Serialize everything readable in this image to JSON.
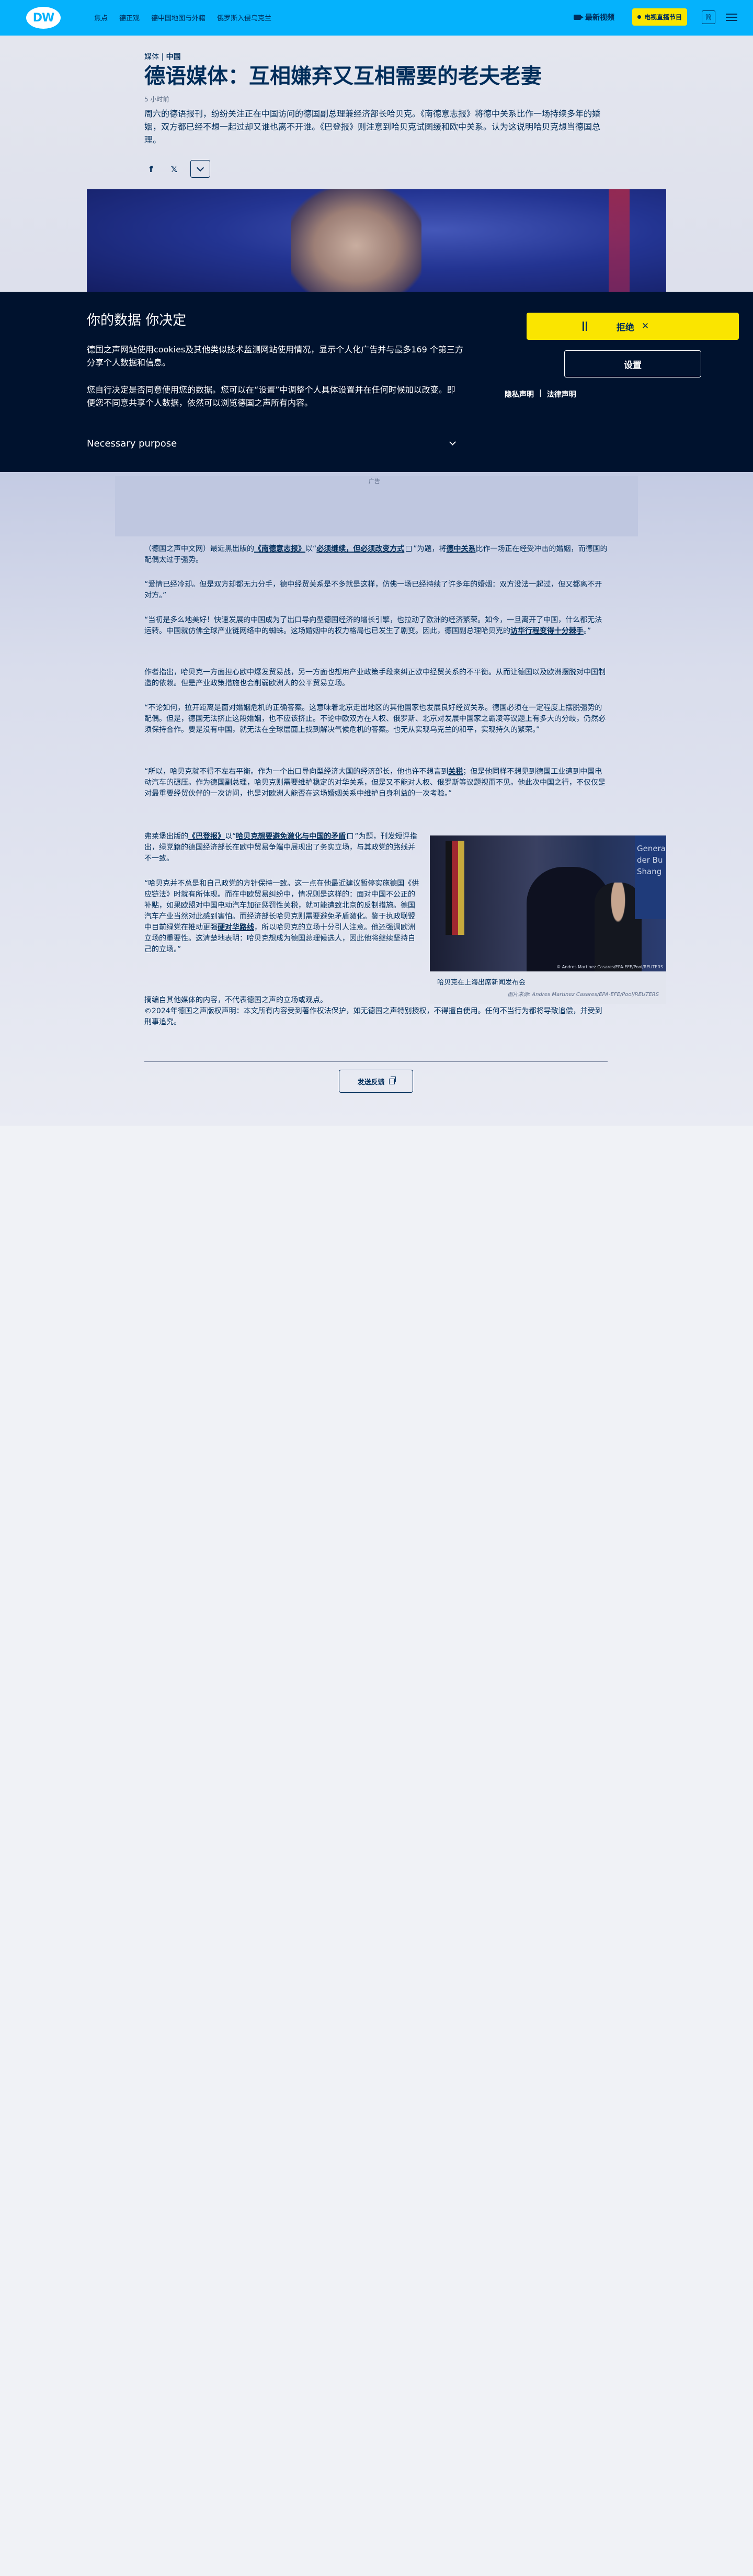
{
  "header": {
    "logo": "DW",
    "nav": [
      "焦点",
      "德正观",
      "德中国地图与外籍",
      "俄罗斯入侵乌克兰"
    ],
    "latest_video": "最新视频",
    "live_tv": "电视直播节目",
    "lang": "简"
  },
  "article": {
    "kicker_prefix": "媒体 |",
    "kicker_tag": "中国",
    "title": "德语媒体：互相嫌弃又互相需要的老夫老妻",
    "time": "5 小时前",
    "lead": "周六的德语报刊，纷纷关注正在中国访问的德国副总理兼经济部长哈贝克。《南德意志报》将德中关系比作一场持续多年的婚姻，双方都已经不想一起过却又谁也离不开谁。《巴登报》则注意到哈贝克试图缓和欧中关系。认为这说明哈贝克想当德国总理。"
  },
  "cookie": {
    "title": "你的数据 你决定",
    "p1": "德国之声网站使用cookies及其他类似技术监测网站使用情况，显示个人化广告并与最多169 个第三方分享个人数据和信息。",
    "p2": "您自行决定是否同意使用您的数据。您可以在“设置”中调整个人具体设置并在任何时候加以改变。即便您不同意共享个人数据，依然可以浏览德国之声所有内容。",
    "purpose": "Necessary purpose",
    "reject": "拒绝",
    "settings": "设置",
    "privacy": "隐私声明",
    "sep": "|",
    "legal": "法律声明"
  },
  "ad_label": "广告",
  "body": {
    "p1_a": "（德国之声中文网）最近黑出版的",
    "p1_link1": "《南德意志报》",
    "p1_b": "以“",
    "p1_link2": "必须继续，但必须改变方式",
    "p1_c": "”为题，将",
    "p1_link3": "德中关系",
    "p1_d": "比作一场正在经受冲击的婚姻，而德国的配偶太过于强势。",
    "p2": "“爱情已经冷却。但是双方却都无力分手，德中经贸关系是不多就是这样，仿佛一场已经持续了许多年的婚姻：双方没法一起过，但又都离不开对方。”",
    "p3_a": "“当初是多么地美好！快速发展的中国成为了出口导向型德国经济的增长引擎，也拉动了欧洲的经济繁荣。如今，一旦离开了中国，什么都无法运转。中国就仿佛全球产业链网络中的蜘蛛。这场婚姻中的权力格局也已发生了剧变。因此，德国副总理哈贝克的",
    "p3_link": "访华行程变得十分棘手",
    "p3_b": "。”",
    "p4": "作者指出，哈贝克一方面担心欧中爆发贸易战，另一方面也想用产业政策手段来纠正欧中经贸关系的不平衡。从而让德国以及欧洲摆脱对中国制造的依赖。但是产业政策措施也会削弱欧洲人的公平贸易立场。",
    "p5": "“不论如何，拉开距离是面对婚姻危机的正确答案。这意味着北京走出地区的其他国家也发展良好经贸关系。德国必须在一定程度上摆脱强势的配偶。但是，德国无法挤止这段婚姻，也不应该挤止。不论中欧双方在人权、俄罗斯、北京对发展中国家之霸凌等议题上有多大的分歧，仍然必须保持合作。要是没有中国，就无法在全球层面上找到解决气候危机的答案。也无从实现乌克兰的和平，实现持久的繁荣。”",
    "p6_a": "“所以，哈贝克就不得不左右平衡。作为一个出口导向型经济大国的经济部长，他也许不想言到",
    "p6_link": "关税",
    "p6_b": "；但是他同样不想见到德国工业遭到中国电动汽车的碾压。作为德国副总理，哈贝克则需要维护稳定的对华关系，但是又不能对人权、俄罗斯等议题视而不见。他此次中国之行，不仅仅是对最重要经贸伙伴的一次访问，也是对欧洲人能否在这场婚姻关系中维护自身利益的一次考验。”",
    "p7_a": "弗莱堡出版的",
    "p7_link1": "《巴登报》",
    "p7_b": "以“",
    "p7_link2": "哈贝克想要避免激化与中国的矛盾",
    "p7_c": "”为题，刊发短评指出，绿党籍的德国经济部长在欧中贸易争端中展现出了务实立场，与其政党的路线并不一致。",
    "p8_a": "“哈贝克并不总是和自己政党的方针保持一致。这一点在他最近建议暂停实施德国《供应链法》时就有所体现。而在中欧贸易纠纷中，情况则是这样的：面对中国不公正的补贴，如果欧盟对中国电动汽车加征惩罚性关税，就可能遭致北京的反制措施。德国汽车产业当然对此感到害怕。而经济部长哈贝克则需要避免矛盾激化。鉴于执政联盟中目前绿党在推动更强",
    "p8_link": "硬对华路线",
    "p8_b": "，所以哈贝克的立场十分引人注意。他还强调欧洲立场的重要性。这清楚地表明：哈贝克想成为德国总理候选人，因此他将继续坚持自己的立场。”",
    "p9": "摘编自其他媒体的内容，不代表德国之声的立场或观点。",
    "p10": "©2024年德国之声版权声明：本文所有内容受到著作权法保护，如无德国之声特别授权，不得擅自使用。任何不当行为都将导致追偿，并受到刑事追究。"
  },
  "figure": {
    "wall_text": "Genera der Bu Shang",
    "credit": "© Andres Martinez Casares/EPA-EFE/Pool/REUTERS",
    "caption": "哈贝克在上海出席新闻发布会",
    "caption_credit": "图片来源: Andres Martinez Casares/EPA-EFE/Pool/REUTERS"
  },
  "feedback_label": "发送反馈",
  "colors": {
    "brand_blue": "#05b2fc",
    "navy": "#002d5a",
    "yellow": "#fae500",
    "banner_bg": "#00122e"
  }
}
